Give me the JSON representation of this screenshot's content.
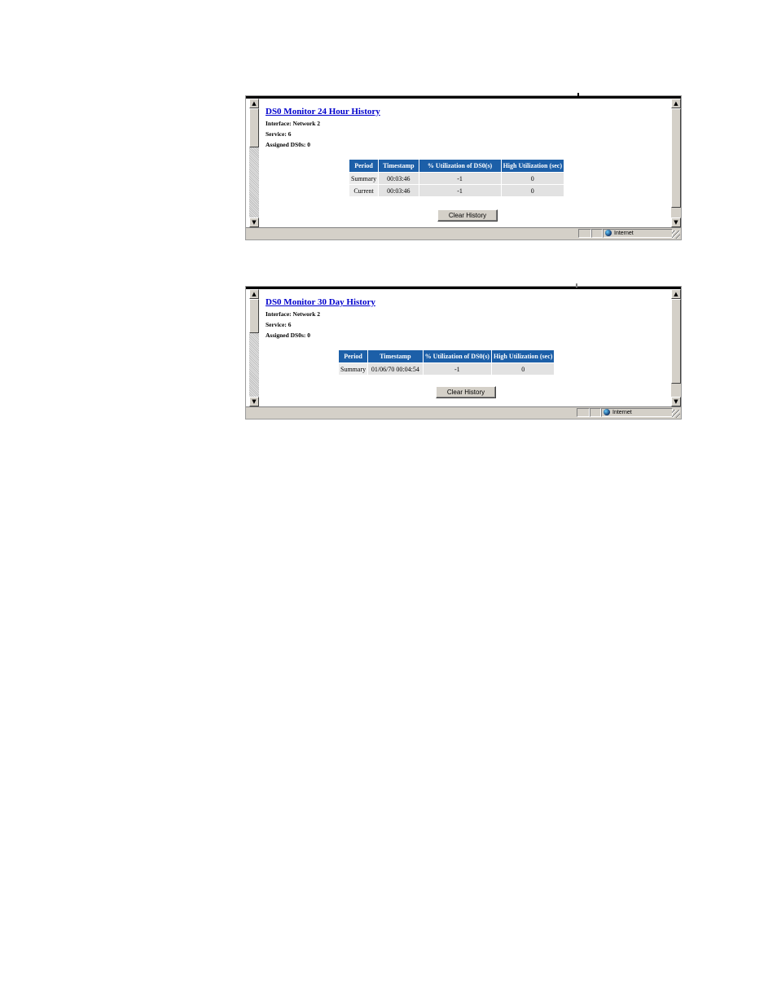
{
  "windows": [
    {
      "title": "DS0 Monitor 24 Hour History",
      "info": [
        "Interface: Network 2",
        "Service: 6",
        "Assigned DS0s: 0"
      ],
      "columns": [
        "Period",
        "Timestamp",
        "% Utilization of DS0(s)",
        "High Utilization (sec)"
      ],
      "rows": [
        [
          "Summary",
          "00:03:46",
          "-1",
          "0"
        ],
        [
          "Current",
          "00:03:46",
          "-1",
          "0"
        ]
      ],
      "button_label": "Clear History",
      "status_zone": "Internet"
    },
    {
      "title": "DS0 Monitor 30 Day History",
      "info": [
        "Interface: Network 2",
        "Service: 6",
        "Assigned DS0s: 0"
      ],
      "columns": [
        "Period",
        "Timestamp",
        "% Utilization of DS0(s)",
        "High Utilization (sec)"
      ],
      "rows": [
        [
          "Summary",
          "01/06/70 00:04:54",
          "-1",
          "0"
        ]
      ],
      "button_label": "Clear History",
      "status_zone": "Internet"
    }
  ],
  "icons": {
    "scroll_up": "▲",
    "scroll_down": "▼",
    "zone": "globe-icon"
  }
}
